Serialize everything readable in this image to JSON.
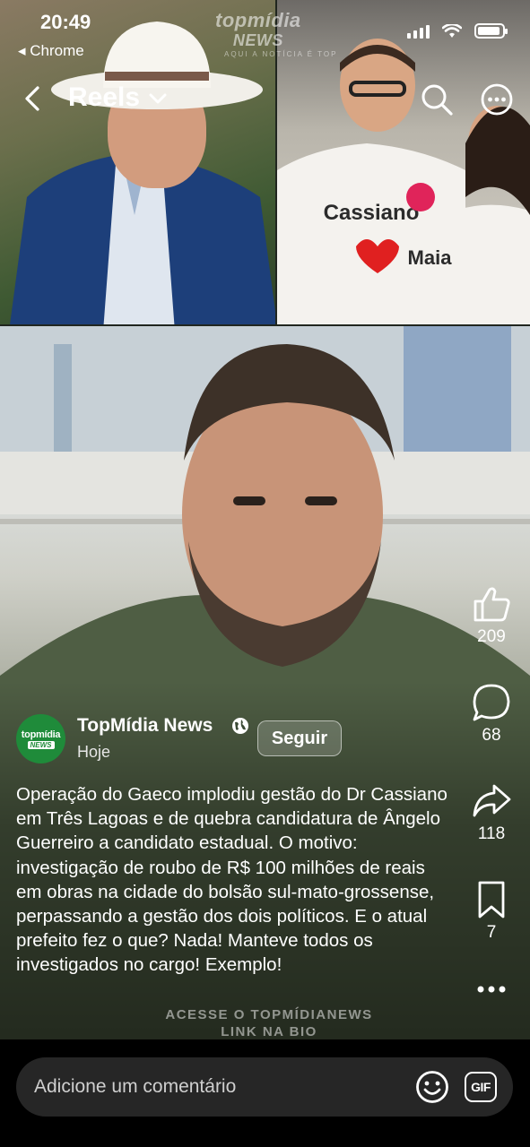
{
  "status_bar": {
    "time": "20:49",
    "back_app": "◂ Chrome"
  },
  "header": {
    "title": "Reels"
  },
  "watermark": {
    "line1": "topmídia",
    "line2": "NEWS",
    "tagline": "AQUI A NOTÍCIA É TOP"
  },
  "actions": {
    "likes": "209",
    "comments": "68",
    "shares": "118",
    "saves": "7"
  },
  "author": {
    "name": "TopMídia News",
    "time": "Hoje",
    "avatar_line1": "topmídia",
    "avatar_line2": "NEWS"
  },
  "follow_label": "Seguir",
  "caption": "Operação do Gaeco implodiu gestão do Dr Cassiano em Três Lagoas e de quebra candidatura de Ângelo Guerreiro a candidato estadual. O motivo: investigação de roubo de R$ 100 milhões de reais em obras na cidade do bolsão sul-mato-grossense, perpassando a gestão dos dois políticos. E o atual prefeito fez o que? Nada! Manteve todos os investigados no cargo! Exemplo!",
  "video_overlay": {
    "line1": "ACESSE O TOPMÍDIANEWS",
    "line2": "LINK NA BIO"
  },
  "comment": {
    "placeholder": "Adicione um comentário",
    "gif_label": "GIF"
  },
  "icons": {
    "back": "chevron-left-icon",
    "dropdown": "chevron-down-icon",
    "search": "search-icon",
    "more": "more-horizontal-icon",
    "like": "thumbs-up-icon",
    "comment": "comment-bubble-icon",
    "share": "share-arrow-icon",
    "save": "bookmark-icon",
    "options": "ellipsis-icon",
    "emoji": "emoji-icon",
    "verified": "globe-icon"
  },
  "colors": {
    "avatar_green": "#1f8b3a",
    "comment_box": "#262626"
  }
}
